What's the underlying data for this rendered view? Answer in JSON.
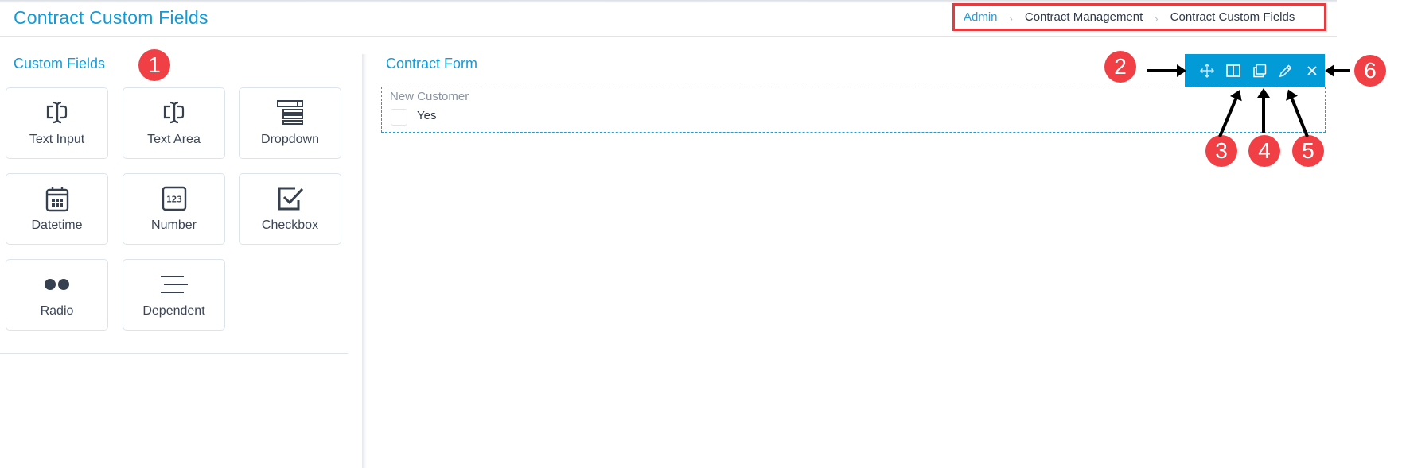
{
  "header": {
    "title": "Contract Custom Fields",
    "breadcrumb": [
      {
        "label": "Admin",
        "link": true
      },
      {
        "label": "Contract Management",
        "link": false
      },
      {
        "label": "Contract Custom Fields",
        "link": false
      }
    ],
    "breadcrumb_separator": "›"
  },
  "custom_fields": {
    "title": "Custom Fields",
    "items": [
      {
        "label": "Text Input",
        "icon": "text-cursor-icon"
      },
      {
        "label": "Text Area",
        "icon": "text-cursor-icon"
      },
      {
        "label": "Dropdown",
        "icon": "dropdown-list-icon"
      },
      {
        "label": "Datetime",
        "icon": "calendar-icon"
      },
      {
        "label": "Number",
        "icon": "number-123-icon"
      },
      {
        "label": "Checkbox",
        "icon": "checkbox-icon"
      },
      {
        "label": "Radio",
        "icon": "radio-dots-icon"
      },
      {
        "label": "Dependent",
        "icon": "lines-icon"
      }
    ]
  },
  "form": {
    "title": "Contract Form",
    "field": {
      "label": "New Customer",
      "option_label": "Yes",
      "checked": false
    },
    "toolbar": [
      "move-icon",
      "columns-icon",
      "duplicate-icon",
      "edit-pencil-icon",
      "close-icon"
    ]
  },
  "annotations": {
    "badges": [
      "1",
      "2",
      "3",
      "4",
      "5",
      "6"
    ],
    "badge_color": "#f04045"
  },
  "colors": {
    "accent": "#129bd8",
    "toolbar": "#039ad8",
    "highlight_border": "#e8393f"
  }
}
